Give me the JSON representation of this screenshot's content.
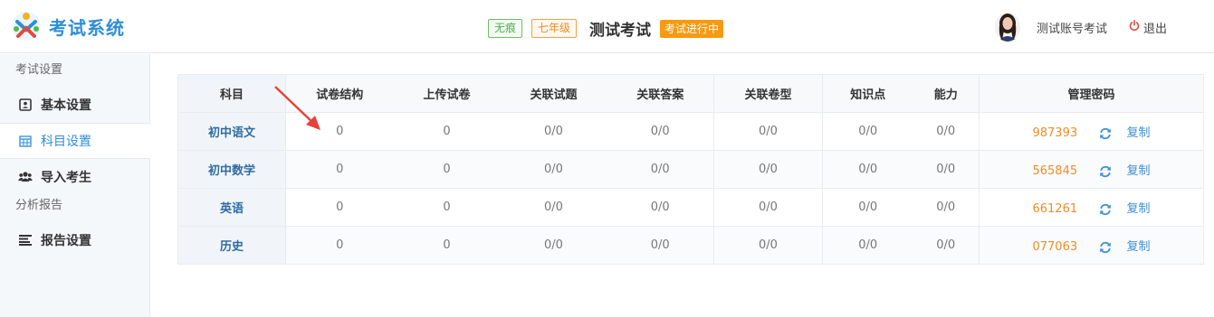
{
  "app": {
    "title": "考试系统"
  },
  "header": {
    "tags": [
      "无痕",
      "七年级"
    ],
    "exam_title": "测试考试",
    "status": "考试进行中",
    "username": "测试账号考试",
    "logout_label": "退出"
  },
  "sidebar": {
    "groups": [
      {
        "label": "考试设置"
      },
      {
        "label": "分析报告"
      }
    ],
    "items": [
      {
        "label": "基本设置",
        "icon": "id-card-icon"
      },
      {
        "label": "科目设置",
        "icon": "calendar-icon",
        "active": true
      },
      {
        "label": "导入考生",
        "icon": "users-icon"
      },
      {
        "label": "报告设置",
        "icon": "list-icon"
      }
    ]
  },
  "table": {
    "headers": [
      "科目",
      "试卷结构",
      "上传试卷",
      "关联试题",
      "关联答案",
      "关联卷型",
      "知识点",
      "能力",
      "管理密码"
    ],
    "copy_label": "复制",
    "rows": [
      {
        "subject": "初中语文",
        "structure": "0",
        "upload": "0",
        "questions": "0/0",
        "answers": "0/0",
        "types": "0/0",
        "knowledge": "0/0",
        "ability": "0/0",
        "password": "987393"
      },
      {
        "subject": "初中数学",
        "structure": "0",
        "upload": "0",
        "questions": "0/0",
        "answers": "0/0",
        "types": "0/0",
        "knowledge": "0/0",
        "ability": "0/0",
        "password": "565845"
      },
      {
        "subject": "英语",
        "structure": "0",
        "upload": "0",
        "questions": "0/0",
        "answers": "0/0",
        "types": "0/0",
        "knowledge": "0/0",
        "ability": "0/0",
        "password": "661261"
      },
      {
        "subject": "历史",
        "structure": "0",
        "upload": "0",
        "questions": "0/0",
        "answers": "0/0",
        "types": "0/0",
        "knowledge": "0/0",
        "ability": "0/0",
        "password": "077063"
      }
    ]
  },
  "colors": {
    "brand": "#2c8fd6",
    "status": "#f59a12",
    "password": "#ef8c26",
    "arrow": "#e8403a"
  }
}
